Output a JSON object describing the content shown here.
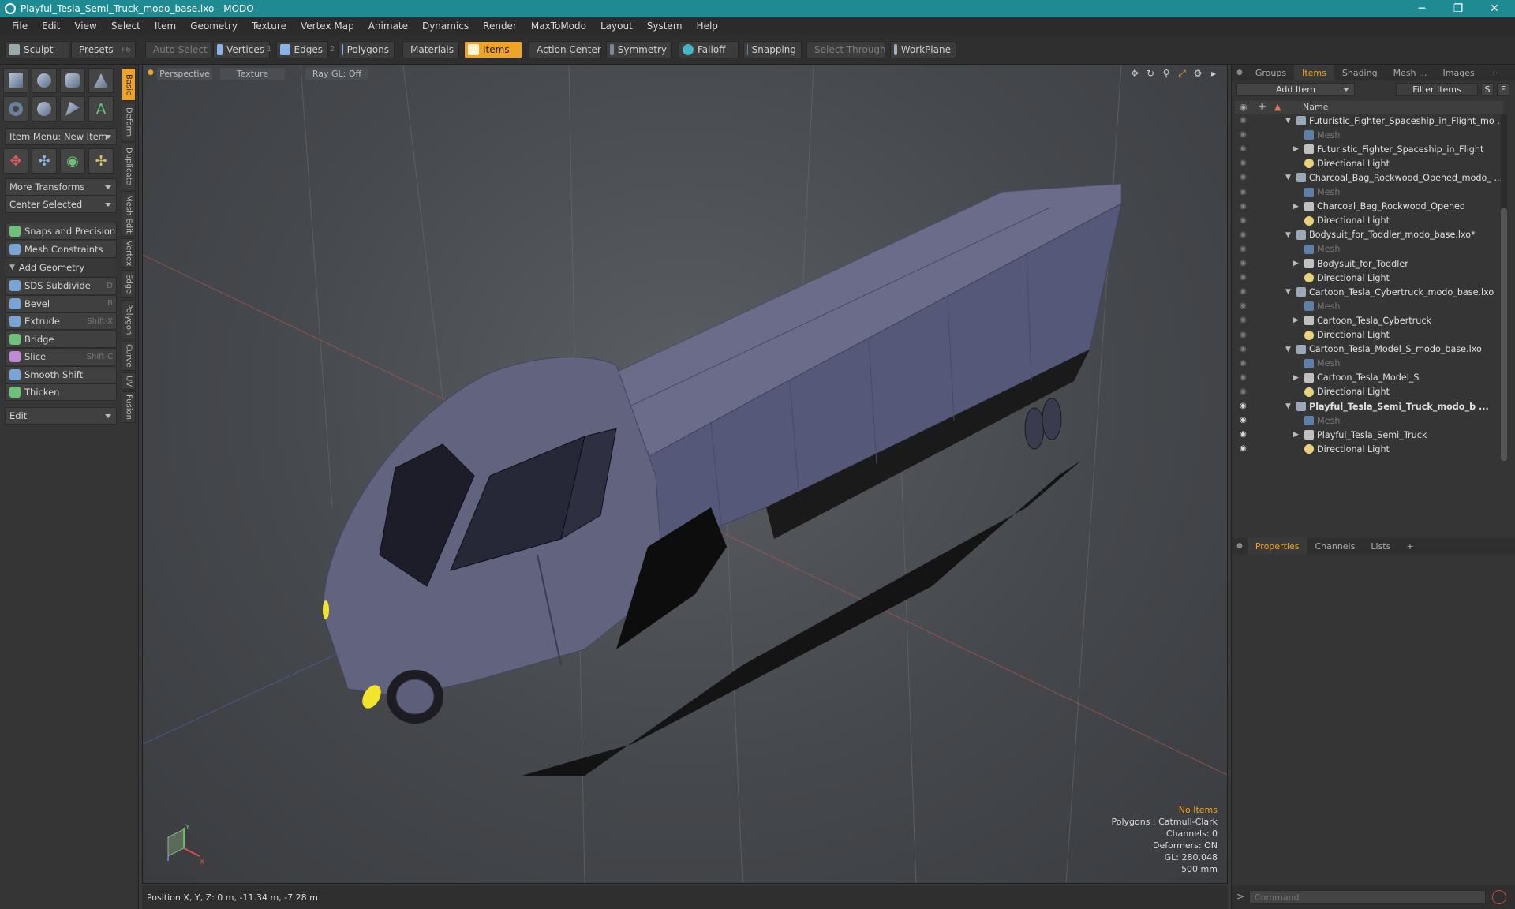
{
  "window": {
    "title": "Playful_Tesla_Semi_Truck_modo_base.lxo - MODO",
    "minimize": "─",
    "restore": "❐",
    "close": "✕"
  },
  "menu": [
    "File",
    "Edit",
    "View",
    "Select",
    "Item",
    "Geometry",
    "Texture",
    "Vertex Map",
    "Animate",
    "Dynamics",
    "Render",
    "MaxToModo",
    "Layout",
    "System",
    "Help"
  ],
  "toolbar": {
    "sculpt": "Sculpt",
    "presets": "Presets",
    "presets_key": "F6",
    "auto_select": "Auto Select",
    "vertices": "Vertices",
    "vertices_num": "1",
    "edges": "Edges",
    "edges_num": "2",
    "polygons": "Polygons",
    "materials": "Materials",
    "items": "Items",
    "action_center": "Action Center",
    "symmetry": "Symmetry",
    "falloff": "Falloff",
    "snapping": "Snapping",
    "select_through": "Select Through",
    "workplane": "WorkPlane"
  },
  "left": {
    "item_menu": "Item Menu: New Item",
    "more_transforms": "More Transforms",
    "center_selected": "Center Selected",
    "snaps": "Snaps and Precision",
    "mesh_constraints": "Mesh Constraints",
    "add_geometry": "Add Geometry",
    "tools": [
      {
        "label": "SDS Subdivide",
        "key": "D",
        "color": "#7aa3d6"
      },
      {
        "label": "Bevel",
        "key": "B",
        "color": "#7aa3d6"
      },
      {
        "label": "Extrude",
        "key": "Shift-X",
        "color": "#7aa3d6"
      },
      {
        "label": "Bridge",
        "key": "",
        "color": "#6ec07a"
      },
      {
        "label": "Slice",
        "key": "Shift-C",
        "color": "#c08ad6"
      },
      {
        "label": "Smooth Shift",
        "key": "",
        "color": "#7aa3d6"
      },
      {
        "label": "Thicken",
        "key": "",
        "color": "#6ec07a"
      }
    ],
    "edit": "Edit",
    "vtabs": [
      "Basic",
      "Deform",
      "Duplicate",
      "Mesh Edit",
      "Vertex",
      "Edge",
      "Polygon",
      "Curve",
      "UV",
      "Fusion"
    ]
  },
  "viewport": {
    "perspective": "Perspective",
    "texture": "Texture",
    "raygl": "Ray GL: Off",
    "info": {
      "no_items": "No Items",
      "polygons": "Polygons : Catmull-Clark",
      "channels": "Channels: 0",
      "deformers": "Deformers: ON",
      "gl": "GL: 280,048",
      "scale": "500 mm"
    },
    "gizmo_y": "Y",
    "gizmo_x": "X"
  },
  "status": {
    "position": "Position X, Y, Z:  0 m, -11.34 m, -7.28 m"
  },
  "right": {
    "tabs": [
      "Groups",
      "Items",
      "Shading",
      "Mesh ...",
      "Images"
    ],
    "add_item": "Add Item",
    "filter_items": "Filter Items",
    "s_btn": "S",
    "f_btn": "F",
    "name_header": "Name",
    "items": [
      {
        "label": "Futuristic_Fighter_Spaceship_in_Flight_mo ...",
        "type": "scene",
        "level": 0,
        "expander": "▼"
      },
      {
        "label": "Mesh",
        "type": "mesh",
        "level": 1,
        "expander": ""
      },
      {
        "label": "Futuristic_Fighter_Spaceship_in_Flight",
        "type": "group",
        "level": 1,
        "expander": "▶"
      },
      {
        "label": "Directional Light",
        "type": "light",
        "level": 1,
        "expander": ""
      },
      {
        "label": "Charcoal_Bag_Rockwood_Opened_modo_ ...",
        "type": "scene",
        "level": 0,
        "expander": "▼"
      },
      {
        "label": "Mesh",
        "type": "mesh",
        "level": 1,
        "expander": ""
      },
      {
        "label": "Charcoal_Bag_Rockwood_Opened",
        "type": "group",
        "level": 1,
        "expander": "▶"
      },
      {
        "label": "Directional Light",
        "type": "light",
        "level": 1,
        "expander": ""
      },
      {
        "label": "Bodysuit_for_Toddler_modo_base.lxo*",
        "type": "scene",
        "level": 0,
        "expander": "▼"
      },
      {
        "label": "Mesh",
        "type": "mesh",
        "level": 1,
        "expander": ""
      },
      {
        "label": "Bodysuit_for_Toddler",
        "type": "group",
        "level": 1,
        "expander": "▶"
      },
      {
        "label": "Directional Light",
        "type": "light",
        "level": 1,
        "expander": ""
      },
      {
        "label": "Cartoon_Tesla_Cybertruck_modo_base.lxo",
        "type": "scene",
        "level": 0,
        "expander": "▼"
      },
      {
        "label": "Mesh",
        "type": "mesh",
        "level": 1,
        "expander": ""
      },
      {
        "label": "Cartoon_Tesla_Cybertruck",
        "type": "group",
        "level": 1,
        "expander": "▶"
      },
      {
        "label": "Directional Light",
        "type": "light",
        "level": 1,
        "expander": ""
      },
      {
        "label": "Cartoon_Tesla_Model_S_modo_base.lxo",
        "type": "scene",
        "level": 0,
        "expander": "▼"
      },
      {
        "label": "Mesh",
        "type": "mesh",
        "level": 1,
        "expander": ""
      },
      {
        "label": "Cartoon_Tesla_Model_S",
        "type": "group",
        "level": 1,
        "expander": "▶"
      },
      {
        "label": "Directional Light",
        "type": "light",
        "level": 1,
        "expander": ""
      },
      {
        "label": "Playful_Tesla_Semi_Truck_modo_b ...",
        "type": "scene",
        "level": 0,
        "expander": "▼",
        "bold": true
      },
      {
        "label": "Mesh",
        "type": "mesh",
        "level": 1,
        "expander": ""
      },
      {
        "label": "Playful_Tesla_Semi_Truck",
        "type": "group",
        "level": 1,
        "expander": "▶"
      },
      {
        "label": "Directional Light",
        "type": "light",
        "level": 1,
        "expander": ""
      }
    ],
    "prop_tabs": [
      "Properties",
      "Channels",
      "Lists"
    ],
    "command_placeholder": "Command"
  }
}
